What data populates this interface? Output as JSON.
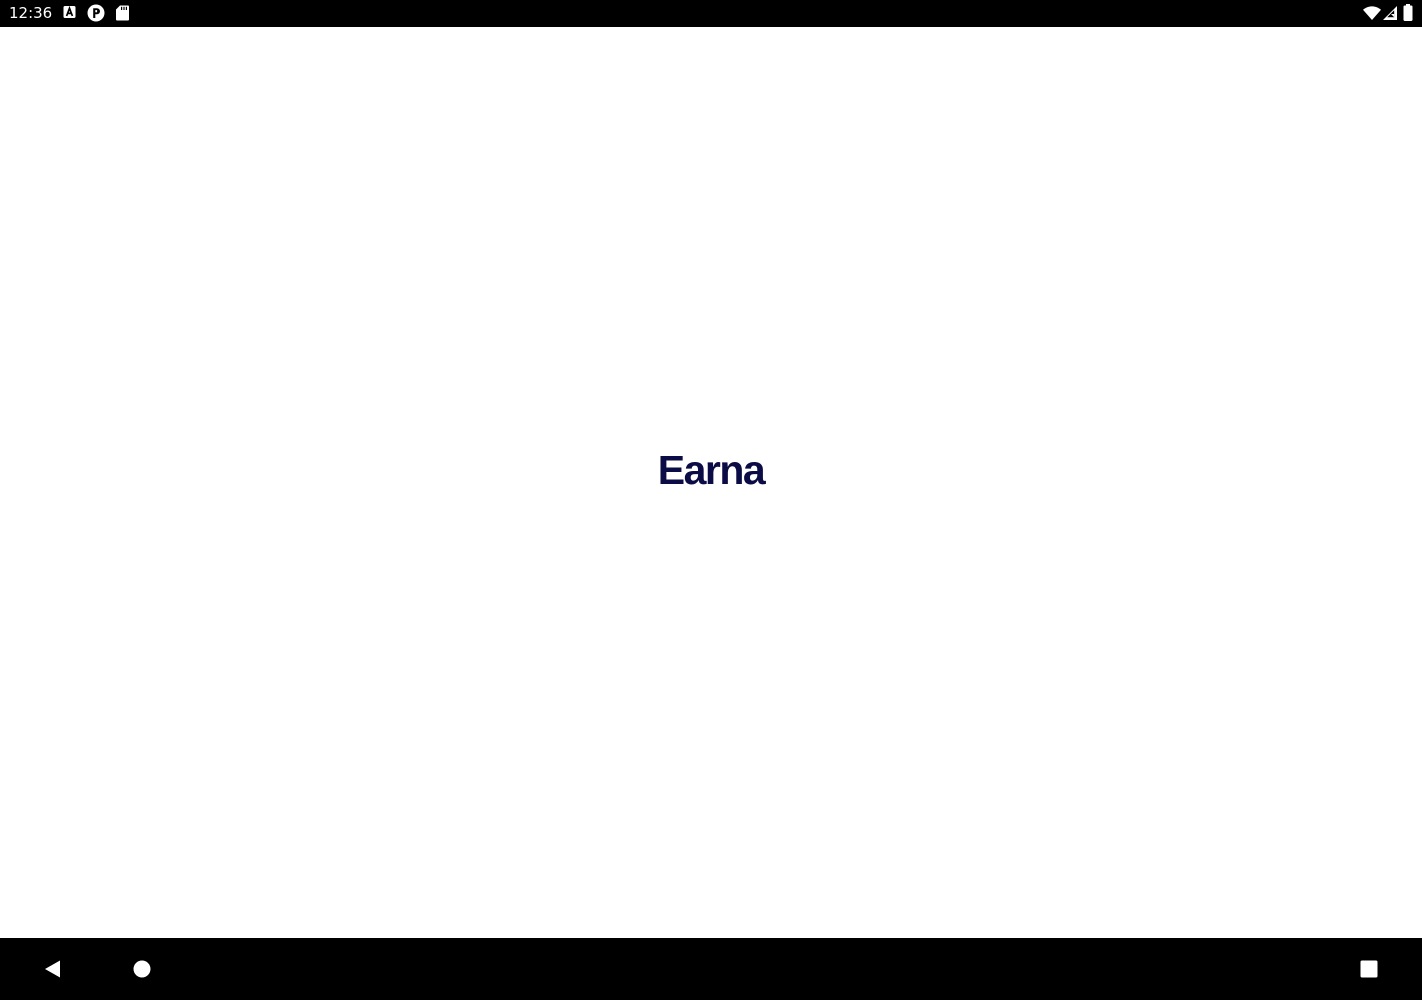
{
  "status_bar": {
    "time": "12:36",
    "notification_icons": [
      "a-box-icon",
      "circle-p-icon",
      "sd-card-icon"
    ],
    "system_icons": [
      "wifi-icon",
      "cell-signal-icon",
      "battery-icon"
    ]
  },
  "splash": {
    "logo_text": "Earna",
    "logo_color": "#0B0B45"
  },
  "nav_bar": {
    "buttons": [
      "back",
      "home",
      "recents"
    ]
  },
  "colors": {
    "bars": "#000000",
    "background": "#FFFFFF"
  }
}
